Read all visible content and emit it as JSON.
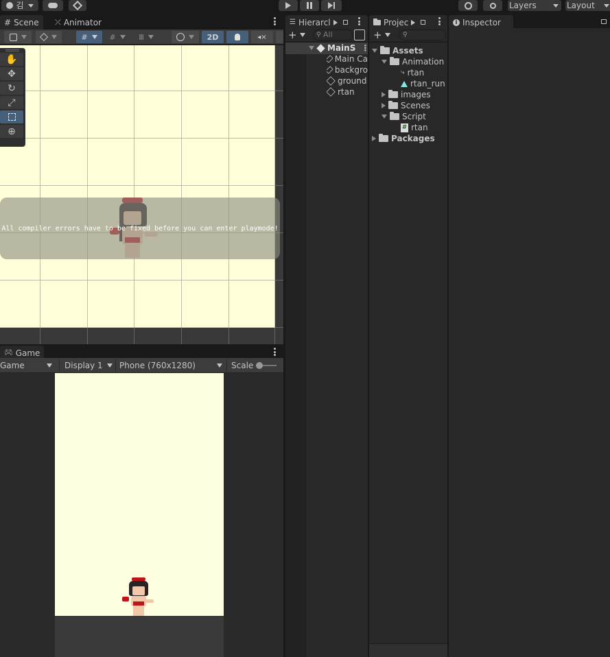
{
  "topbar": {
    "account_label": "김",
    "play_icon": "play-icon",
    "pause_icon": "pause-icon",
    "step_icon": "step-icon",
    "layers_label": "Layers",
    "layout_label": "Layout"
  },
  "scene_panel": {
    "tabs": [
      {
        "label": "Scene",
        "icon": "grid-icon"
      },
      {
        "label": "Animator",
        "icon": "animator-icon"
      }
    ],
    "toolbar": {
      "mode_2d": "2D"
    },
    "compiler_message": "All compiler errors have to be fixed before you can enter playmode!",
    "tools": [
      "hand",
      "move",
      "rotate",
      "scale",
      "rect",
      "transform"
    ]
  },
  "game_panel": {
    "tab_label": "Game",
    "view_select": "Game",
    "display_select": "Display 1",
    "resolution_select": "Phone (760x1280)",
    "scale_label": "Scale"
  },
  "hierarchy": {
    "tab_label": "Hierarcl",
    "search_placeholder": "All",
    "scene_name": "MainS",
    "items": [
      "Main Ca",
      "backgro",
      "ground",
      "rtan"
    ]
  },
  "project": {
    "tab_label": "Projec",
    "tree": {
      "assets": "Assets",
      "animation": "Animation",
      "rtan_anim": "rtan",
      "rtan_run": "rtan_run",
      "images": "images",
      "scenes": "Scenes",
      "script": "Script",
      "rtan_script": "rtan",
      "packages": "Packages"
    }
  },
  "inspector": {
    "tab_label": "Inspector"
  },
  "colors": {
    "accent_blue": "#46607c",
    "scene_bg": "#fefed8",
    "game_bg": "#fefee0"
  }
}
